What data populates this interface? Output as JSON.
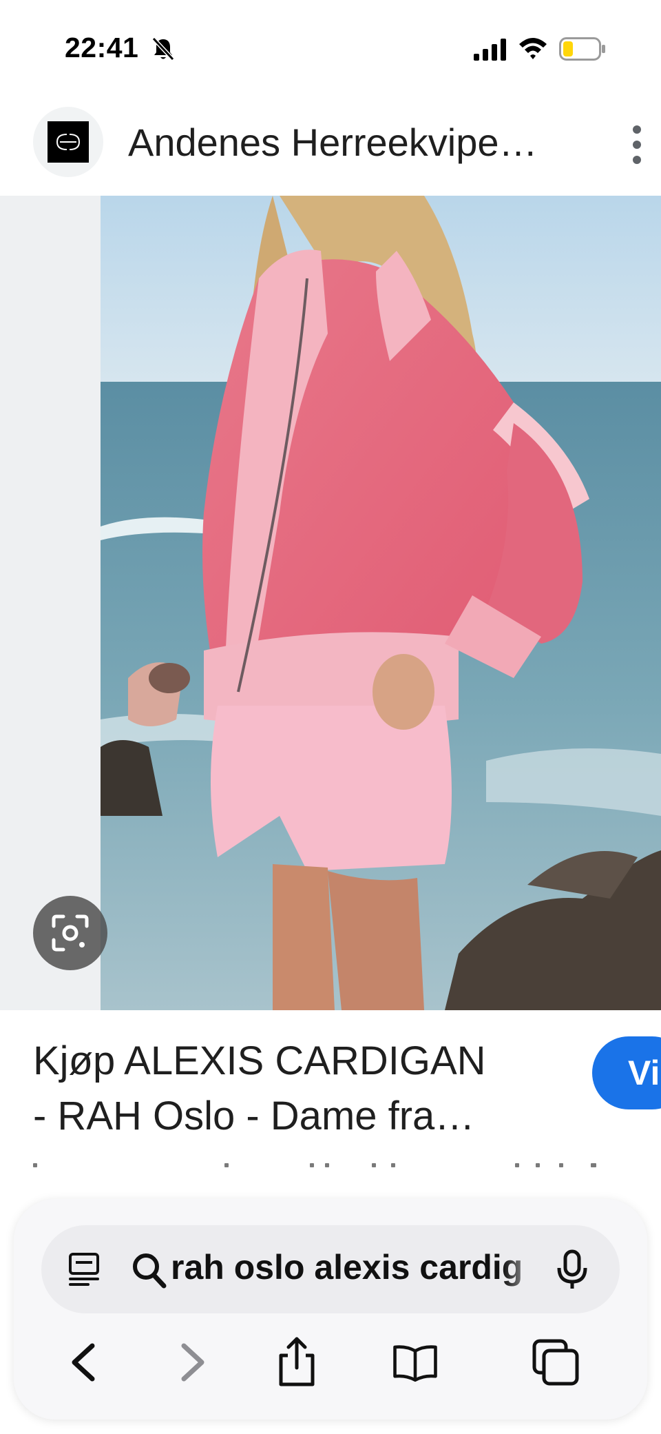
{
  "status_bar": {
    "time": "22:41",
    "icons": [
      "bell-muted-icon",
      "signal-icon",
      "wifi-icon",
      "battery-icon"
    ]
  },
  "header": {
    "site_name": "Andenes Herreekvipe…",
    "logo_icon": "site-logo",
    "menu_icon": "more-icon"
  },
  "image": {
    "description_icon": "lens-icon"
  },
  "result": {
    "caption_line1": "Kjøp ALEXIS CARDIGAN",
    "caption_line2": "- RAH Oslo - Dame fra…",
    "visit_label": "Vi"
  },
  "toolbar": {
    "address_text": "rah oslo alexis cardig",
    "icons": [
      "tabs-overview-icon",
      "search-icon",
      "mic-icon",
      "back-icon",
      "forward-icon",
      "share-icon",
      "bookmarks-icon",
      "tabs-icon"
    ]
  },
  "colors": {
    "accent": "#1a73e8",
    "image_bg": "#eef0f2",
    "toolbar_bg": "#f7f7f9",
    "address_bg": "#ececef",
    "battery_low": "#ffd60a"
  }
}
